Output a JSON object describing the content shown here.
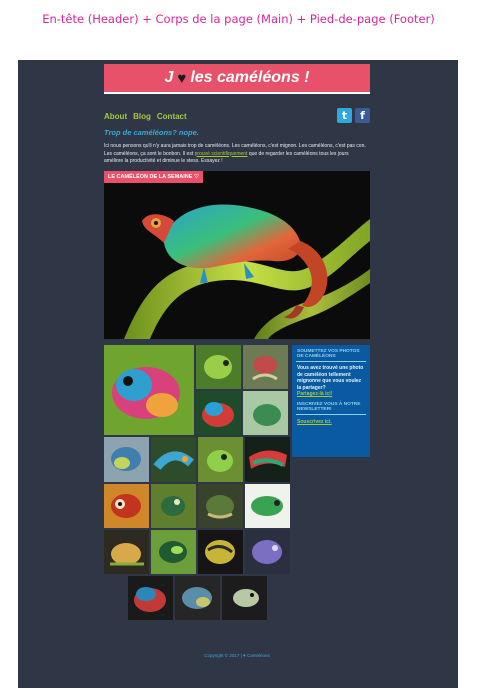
{
  "caption": "En-tête (Header) + Corps de la page (Main)  + Pied-de-page (Footer)",
  "header": {
    "letter": "J",
    "heart_icon": "heart-icon",
    "title": "les caméléons !",
    "color": "#e8516a"
  },
  "nav": {
    "items": [
      "About",
      "Blog",
      "Contact"
    ],
    "color": "#a3c93a"
  },
  "social": {
    "twitter": "t",
    "facebook": "f"
  },
  "tagline": "Trop de caméléons? nope.",
  "intro": {
    "text_before": "Ici nous pensons qu'il n'y aura jamais trop de caméléons. Les caméléons, c'est mignon. Les caméléons, c'est pas con. Les caméléons, ça sont le bonbon. Il est",
    "link": "prouvé scientifiquement",
    "text_after": "que de regarder les caméléons tous les jours améliore la productivité et diminue le stess. Essayez !"
  },
  "week": {
    "label": "LE CAMÉLÉON DE LA SEMAINE ♡"
  },
  "sidebar": {
    "submit_heading": "SOUMETTEZ VOS PHOTOS DE CAMÉLÉONS",
    "submit_text": "Vous avez trouvé une photo de caméléon tellement mignonne que vous voulez la partager?",
    "submit_link": "Partagez-là ici!",
    "newsletter_heading": "INSCRIVEZ VOUS À NOTRE NEWSLETTER!",
    "newsletter_link": "Souscrivez ici."
  },
  "footer": {
    "text": "Copyright © 2017 | ♥ Caméléons"
  }
}
